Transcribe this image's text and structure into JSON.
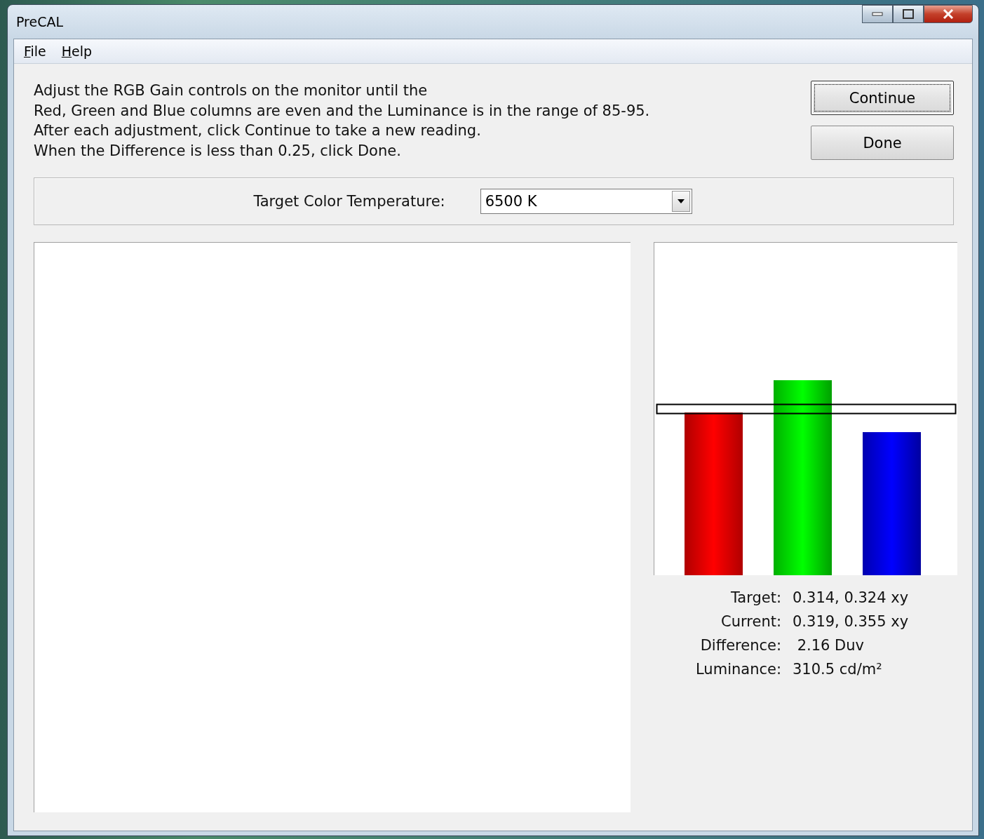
{
  "window": {
    "title": "PreCAL"
  },
  "menu": [
    {
      "label": "File"
    },
    {
      "label": "Help"
    }
  ],
  "instructions": [
    "Adjust the RGB Gain controls on the monitor until the",
    "Red, Green and Blue columns are even and the Luminance is in the range of 85-95.",
    "After each adjustment, click Continue to take a new reading.",
    "When the Difference is less than 0.25, click Done."
  ],
  "buttons": [
    {
      "label": "Continue",
      "focused": true
    },
    {
      "label": "Done",
      "focused": false
    }
  ],
  "target_temperature": {
    "label": "Target Color Temperature:",
    "value": "6500 K"
  },
  "readings": [
    {
      "label": "Target:",
      "value": "0.314, 0.324 xy"
    },
    {
      "label": "Current:",
      "value": "0.319, 0.355 xy"
    },
    {
      "label": "Difference:",
      "value": " 2.16 Duv"
    },
    {
      "label": "Luminance:",
      "value": "310.5 cd/m²"
    }
  ]
}
